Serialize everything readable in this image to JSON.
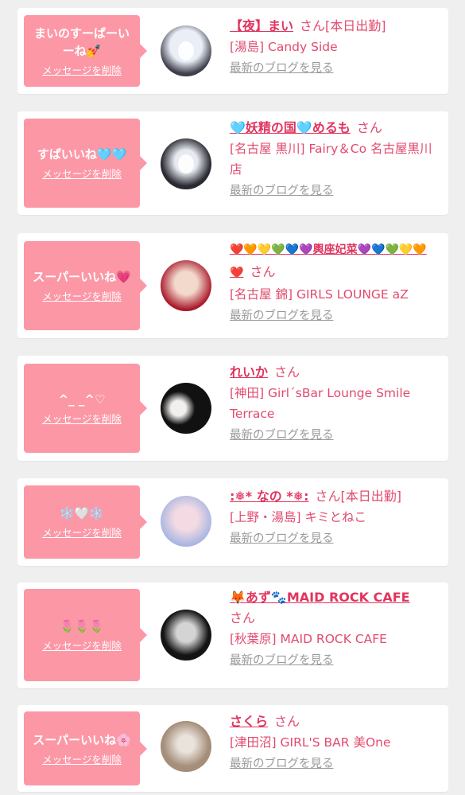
{
  "cards": [
    {
      "message": "まいのすーぱーいーね💅",
      "delete_label": "メッセージを削除",
      "name": "【夜】まい",
      "san": "さん",
      "work_status": "[本日出勤]",
      "shop": "[湯島] Candy Side",
      "blog_link": "最新のブログを見る",
      "avatar_colors": [
        "#cfd8e8",
        "#4a4a58"
      ]
    },
    {
      "message": "すぱいいね🩵🩵",
      "delete_label": "メッセージを削除",
      "name": "🩵妖精の国🩵めるも",
      "san": "さん",
      "work_status": "",
      "shop": "[名古屋 黒川] Fairy＆Co 名古屋黒川店",
      "blog_link": "最新のブログを見る",
      "avatar_colors": [
        "#2a2a33",
        "#dfe3ea"
      ]
    },
    {
      "message": "スーパーいいね💗",
      "delete_label": "メッセージを削除",
      "name": "❤️🧡💛💚💙💜輿座妃菜💜💙💚💛🧡❤️",
      "san": "さん",
      "work_status": "",
      "shop": "[名古屋 錦] GIRLS LOUNGE aZ",
      "blog_link": "最新のブログを見る",
      "avatar_colors": [
        "#b01a2c",
        "#f1c6b6"
      ]
    },
    {
      "message": "^_ _^♡",
      "delete_label": "メッセージを削除",
      "name": "れいか",
      "san": "さん",
      "work_status": "",
      "shop": "[神田] Girl´sBar Lounge Smile Terrace",
      "blog_link": "最新のブログを見る",
      "avatar_colors": [
        "#121212",
        "#e8e0d8"
      ]
    },
    {
      "message": "❄️🤍❄️",
      "delete_label": "メッセージを削除",
      "name": ":❅* なの *❅:",
      "san": "さん",
      "work_status": "[本日出勤]",
      "shop": "[上野・湯島] キミとねこ",
      "blog_link": "最新のブログを見る",
      "avatar_colors": [
        "#b9c3e8",
        "#f0c7d6"
      ]
    },
    {
      "message": "🌷🌷🌷",
      "delete_label": "メッセージを削除",
      "name": "🦊あず🐾MAID ROCK CAFE",
      "san": "さん",
      "work_status": "",
      "shop": "[秋葉原] MAID ROCK CAFE",
      "blog_link": "最新のブログを見る",
      "avatar_colors": [
        "#141414",
        "#c9c9c9"
      ]
    },
    {
      "message": "スーパーいいね🌸",
      "delete_label": "メッセージを削除",
      "name": "さくら",
      "san": "さん",
      "work_status": "",
      "shop": "[津田沼] GIRL'S BAR 美One",
      "blog_link": "最新のブログを見る",
      "avatar_colors": [
        "#b19a88",
        "#e9e3dc"
      ]
    }
  ]
}
